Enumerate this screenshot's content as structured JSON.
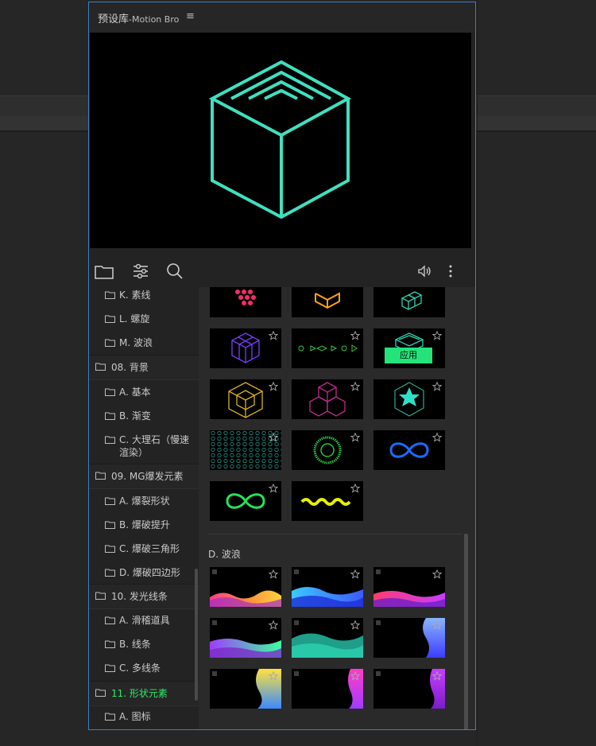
{
  "panel": {
    "title": "预设库",
    "subtitle": "-Motion Bro",
    "menu_glyph": "≡"
  },
  "toolbar": {
    "icons": [
      "folder-icon",
      "sliders-icon",
      "search-icon",
      "speaker-icon",
      "more-vertical-icon"
    ]
  },
  "tree": {
    "items": [
      {
        "label": "K. 素线",
        "level": 2
      },
      {
        "label": "L. 螺旋",
        "level": 2
      },
      {
        "label": "M. 波浪",
        "level": 2
      },
      {
        "label": "08. 背景",
        "level": 1
      },
      {
        "label": "A. 基本",
        "level": 2
      },
      {
        "label": "B. 渐变",
        "level": 2
      },
      {
        "label": "C. 大理石（慢速渲染）",
        "line1": "C. 大理石（慢速",
        "line2": "渲染）",
        "level": 2
      },
      {
        "label": "09. MG爆发元素",
        "level": 1
      },
      {
        "label": "A. 爆裂形状",
        "level": 2
      },
      {
        "label": "B. 爆破提升",
        "level": 2
      },
      {
        "label": "C. 爆破三角形",
        "level": 2
      },
      {
        "label": "D. 爆破四边形",
        "level": 2
      },
      {
        "label": "10. 发光线条",
        "level": 1
      },
      {
        "label": "A. 滑稽道具",
        "level": 2
      },
      {
        "label": "B. 线条",
        "level": 2
      },
      {
        "label": "C. 多线条",
        "level": 2
      },
      {
        "label": "11. 形状元素",
        "level": 1,
        "active": true
      },
      {
        "label": "A. 图标",
        "level": 2
      }
    ]
  },
  "grid": {
    "apply_label": "应用",
    "section_d_label": "D. 波浪",
    "accent_apply": "#25e37b"
  },
  "colors": {
    "panel_border": "#3d7fc4",
    "cube_stroke": "#3fe0c0",
    "active_category": "#2ee86a"
  }
}
